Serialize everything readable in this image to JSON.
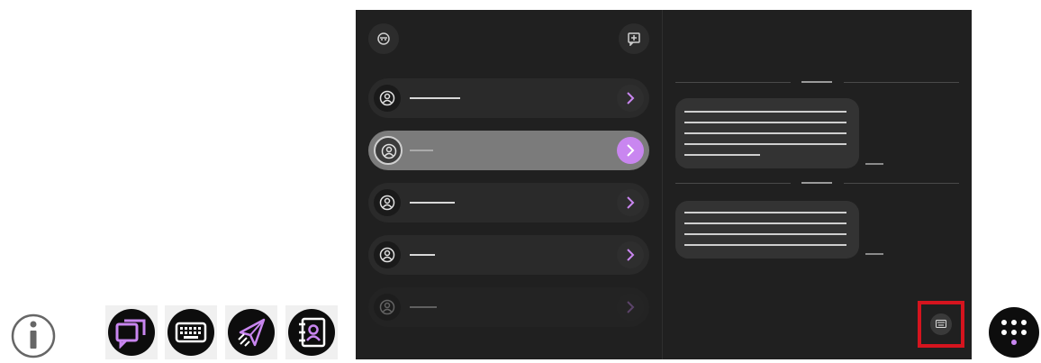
{
  "taskbar": {
    "info_icon": "info-icon",
    "apps": [
      {
        "name": "messages-app",
        "icon": "chat-bubbles-icon"
      },
      {
        "name": "keyboard-app",
        "icon": "keyboard-icon"
      },
      {
        "name": "send-app",
        "icon": "paper-plane-icon"
      },
      {
        "name": "contacts-app",
        "icon": "contact-book-icon"
      }
    ],
    "dialpad_icon": "dialpad-icon"
  },
  "colors": {
    "panel_bg": "#202020",
    "accent": "#c986f0",
    "highlight_box": "#d5141e"
  },
  "sidebar": {
    "top_left_icon": "mask-icon",
    "top_right_icon": "new-message-icon",
    "contacts": [
      {
        "state": "normal"
      },
      {
        "state": "selected"
      },
      {
        "state": "normal"
      },
      {
        "state": "normal"
      },
      {
        "state": "faded"
      }
    ]
  },
  "chat": {
    "bubbles": 2,
    "keyboard_button_icon": "keyboard-icon"
  }
}
